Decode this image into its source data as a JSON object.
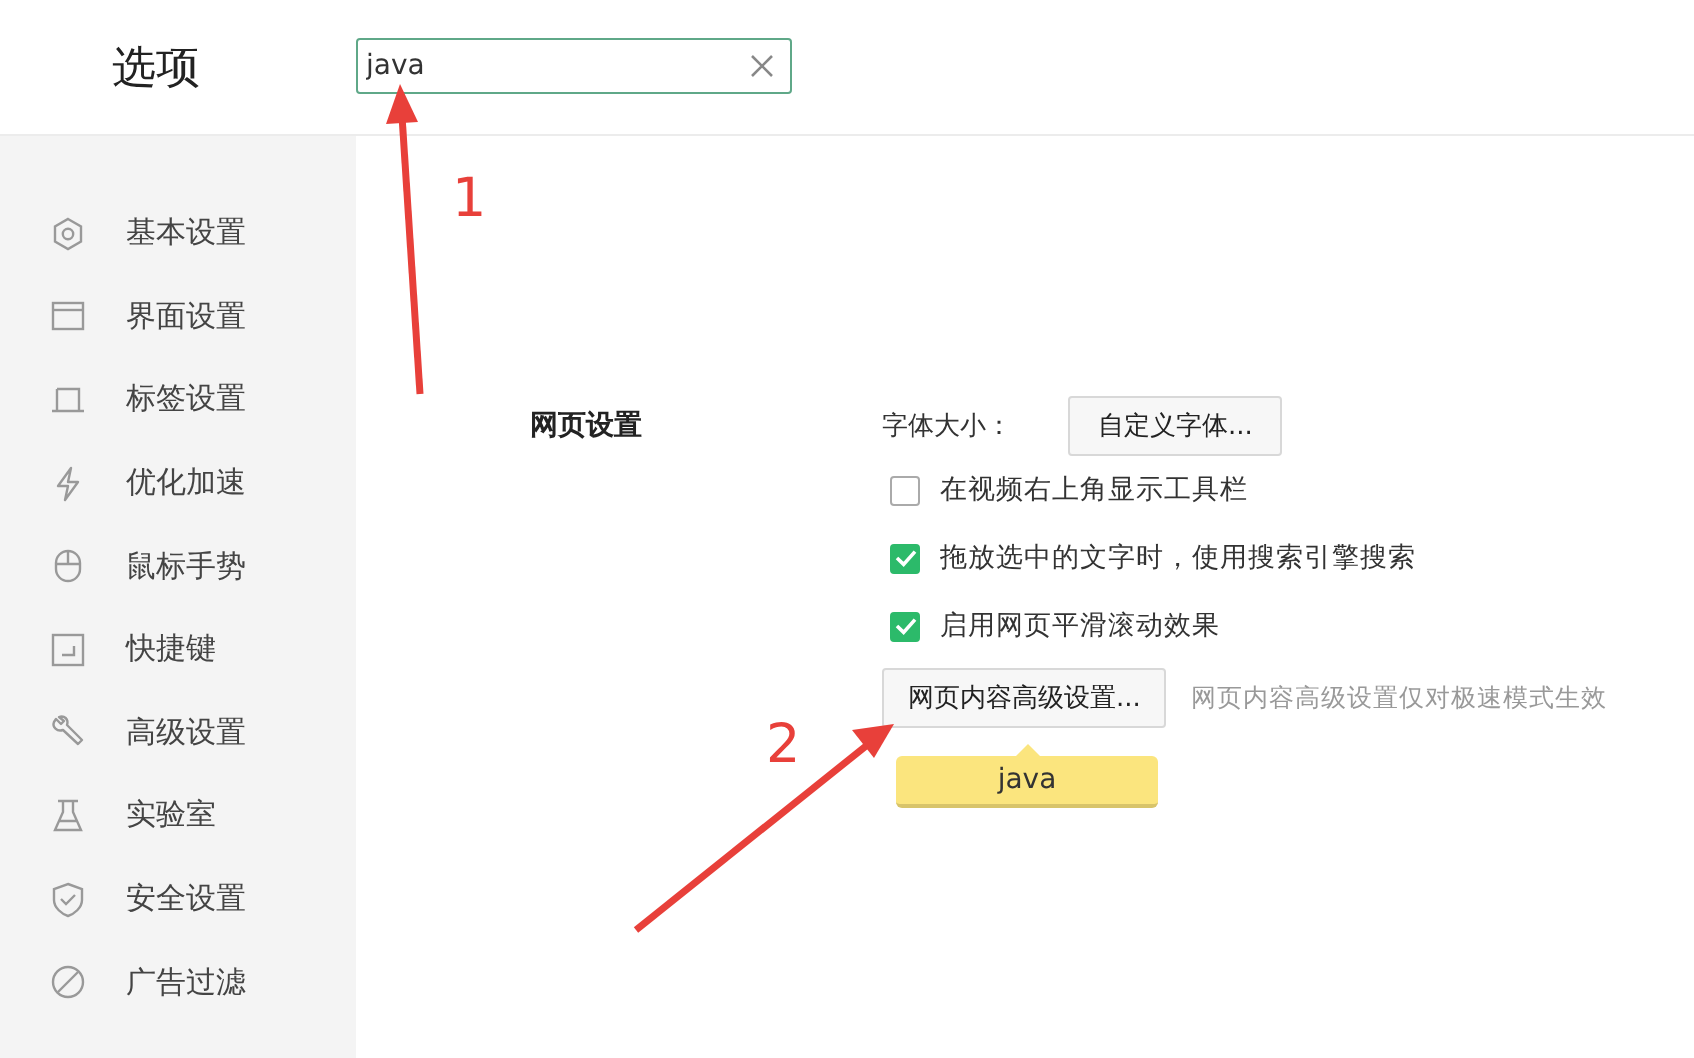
{
  "window": {
    "title": "选项"
  },
  "search": {
    "value": "java"
  },
  "sidebar": {
    "items": [
      {
        "label": "基本设置"
      },
      {
        "label": "界面设置"
      },
      {
        "label": "标签设置"
      },
      {
        "label": "优化加速"
      },
      {
        "label": "鼠标手势"
      },
      {
        "label": "快捷键"
      },
      {
        "label": "高级设置"
      },
      {
        "label": "实验室"
      },
      {
        "label": "安全设置"
      },
      {
        "label": "广告过滤"
      }
    ]
  },
  "section": {
    "title": "网页设置",
    "font_size": {
      "label": "字体大小：",
      "button": "自定义字体..."
    },
    "options": [
      {
        "label": "在视频右上角显示工具栏",
        "checked": false
      },
      {
        "label": "拖放选中的文字时，使用搜索引擎搜索",
        "checked": true
      },
      {
        "label": "启用网页平滑滚动效果",
        "checked": true
      }
    ],
    "advanced": {
      "button": "网页内容高级设置...",
      "note": "网页内容高级设置仅对极速模式生效",
      "tooltip": "java"
    }
  },
  "annotations": [
    {
      "number": "1"
    },
    {
      "number": "2"
    }
  ]
}
